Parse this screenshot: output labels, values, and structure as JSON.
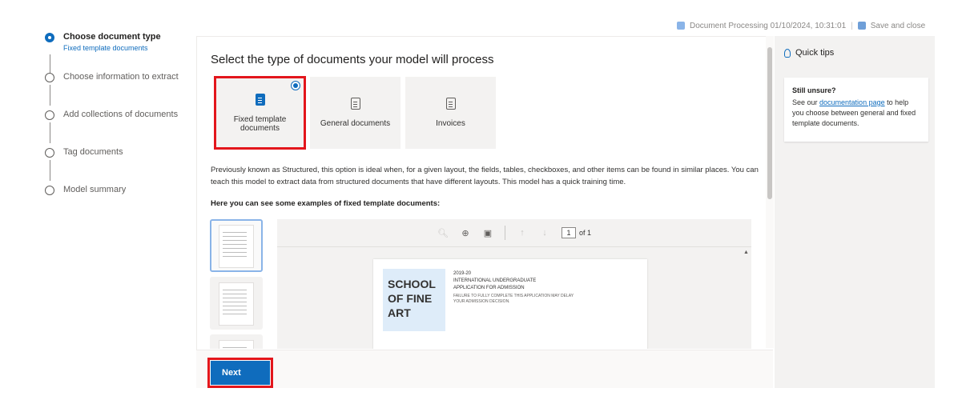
{
  "topbar": {
    "status": "Document Processing 01/10/2024, 10:31:01",
    "save_close": "Save and close"
  },
  "stepper": {
    "steps": [
      {
        "label": "Choose document type",
        "sub": "Fixed template documents"
      },
      {
        "label": "Choose information to extract"
      },
      {
        "label": "Add collections of documents"
      },
      {
        "label": "Tag documents"
      },
      {
        "label": "Model summary"
      }
    ]
  },
  "main": {
    "title": "Select the type of documents your model will process",
    "cards": [
      {
        "label": "Fixed template documents"
      },
      {
        "label": "General documents"
      },
      {
        "label": "Invoices"
      }
    ],
    "description": "Previously known as Structured, this option is ideal when, for a given layout, the fields, tables, checkboxes, and other items can be found in similar places. You can teach this model to extract data from structured documents that have different layouts. This model has a quick training time.",
    "examples_heading": "Here you can see some examples of fixed template documents:",
    "viewer": {
      "page_value": "1",
      "page_of": "of 1",
      "doc_logo": "SCHOOL OF FINE ART",
      "doc_year": "2019-20",
      "doc_line1": "INTERNATIONAL UNDERGRADUATE",
      "doc_line2": "APPLICATION FOR ADMISSION",
      "doc_note": "FAILURE TO FULLY COMPLETE THIS APPLICATION MAY DELAY YOUR ADMISSION DECISION."
    }
  },
  "footer": {
    "next_label": "Next"
  },
  "tips": {
    "title": "Quick tips",
    "card_title": "Still unsure?",
    "text_before": "See our ",
    "link": "documentation page",
    "text_after": " to help you choose between general and fixed template documents."
  },
  "colors": {
    "accent": "#0f6cbd",
    "highlight": "#e3161c"
  }
}
